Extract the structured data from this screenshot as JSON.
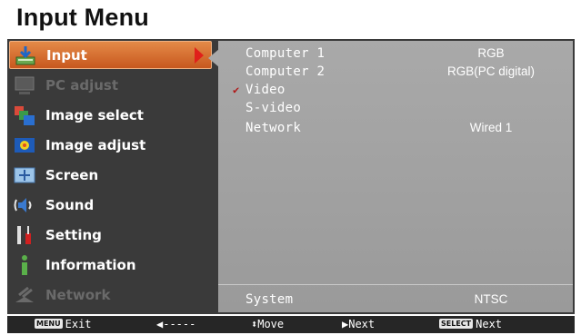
{
  "page": {
    "title": "Input Menu"
  },
  "sidebar": {
    "items": [
      {
        "label": "Input",
        "icon": "input-icon",
        "state": "selected"
      },
      {
        "label": "PC adjust",
        "icon": "pc-adjust-icon",
        "state": "disabled"
      },
      {
        "label": "Image select",
        "icon": "image-select-icon",
        "state": "normal"
      },
      {
        "label": "Image adjust",
        "icon": "image-adjust-icon",
        "state": "normal"
      },
      {
        "label": "Screen",
        "icon": "screen-icon",
        "state": "normal"
      },
      {
        "label": "Sound",
        "icon": "sound-icon",
        "state": "normal"
      },
      {
        "label": "Setting",
        "icon": "setting-icon",
        "state": "normal"
      },
      {
        "label": "Information",
        "icon": "information-icon",
        "state": "normal"
      },
      {
        "label": "Network",
        "icon": "network-icon",
        "state": "disabled"
      }
    ]
  },
  "panel": {
    "options": [
      {
        "label": "Computer 1",
        "value": "RGB",
        "checked": false
      },
      {
        "label": "Computer 2",
        "value": "RGB(PC digital)",
        "checked": false
      },
      {
        "label": "Video",
        "value": "",
        "checked": true
      },
      {
        "label": "S-video",
        "value": "",
        "checked": false
      },
      {
        "label": "Network",
        "value": "Wired 1",
        "checked": false
      }
    ],
    "system": {
      "label": "System",
      "value": "NTSC"
    },
    "check_mark": "✔"
  },
  "footer": {
    "exit": {
      "key": "MENU",
      "label": "Exit"
    },
    "back": {
      "label": "◀-----"
    },
    "move": {
      "label": "⬍Move"
    },
    "next": {
      "label": "▶Next"
    },
    "select": {
      "key": "SELECT",
      "label": "Next"
    }
  },
  "colors": {
    "accent": "#d4692a",
    "panel": "#a3a3a3",
    "frame": "#3a3a3a",
    "footer": "#262626",
    "check": "#b01818"
  }
}
